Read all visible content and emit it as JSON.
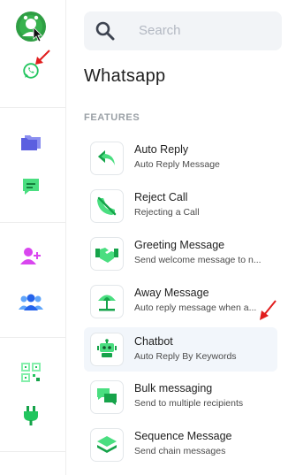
{
  "rail": {
    "items": [
      {
        "icon": "app-logo-icon"
      },
      {
        "icon": "whatsapp-icon"
      },
      {
        "icon": "folder-icon"
      },
      {
        "icon": "chat-icon"
      },
      {
        "icon": "add-user-icon"
      },
      {
        "icon": "users-group-icon"
      },
      {
        "icon": "qr-code-icon"
      },
      {
        "icon": "plug-icon"
      }
    ]
  },
  "search": {
    "placeholder": "Search",
    "value": ""
  },
  "main": {
    "title": "Whatsapp",
    "section_label": "FEATURES",
    "features": [
      {
        "name": "Auto Reply",
        "description": "Auto Reply Message",
        "icon": "reply-icon"
      },
      {
        "name": "Reject Call",
        "description": "Rejecting a Call",
        "icon": "reject-call-icon"
      },
      {
        "name": "Greeting Message",
        "description": "Send welcome message to n...",
        "icon": "handshake-icon"
      },
      {
        "name": "Away Message",
        "description": "Auto reply message when a...",
        "icon": "beach-umbrella-icon"
      },
      {
        "name": "Chatbot",
        "description": "Auto Reply By Keywords",
        "icon": "robot-icon",
        "active": true
      },
      {
        "name": "Bulk messaging",
        "description": "Send to multiple recipients",
        "icon": "bulk-messages-icon"
      },
      {
        "name": "Sequence Message",
        "description": "Send chain messages",
        "icon": "layers-icon"
      }
    ]
  },
  "colors": {
    "accent_green": "#22c55e",
    "folder_purple": "#6366f1",
    "add_user_magenta": "#d946ef",
    "group_blue": "#3b82f6",
    "active_row_bg": "#f2f6fb",
    "annotation_red": "#e11d1d"
  }
}
